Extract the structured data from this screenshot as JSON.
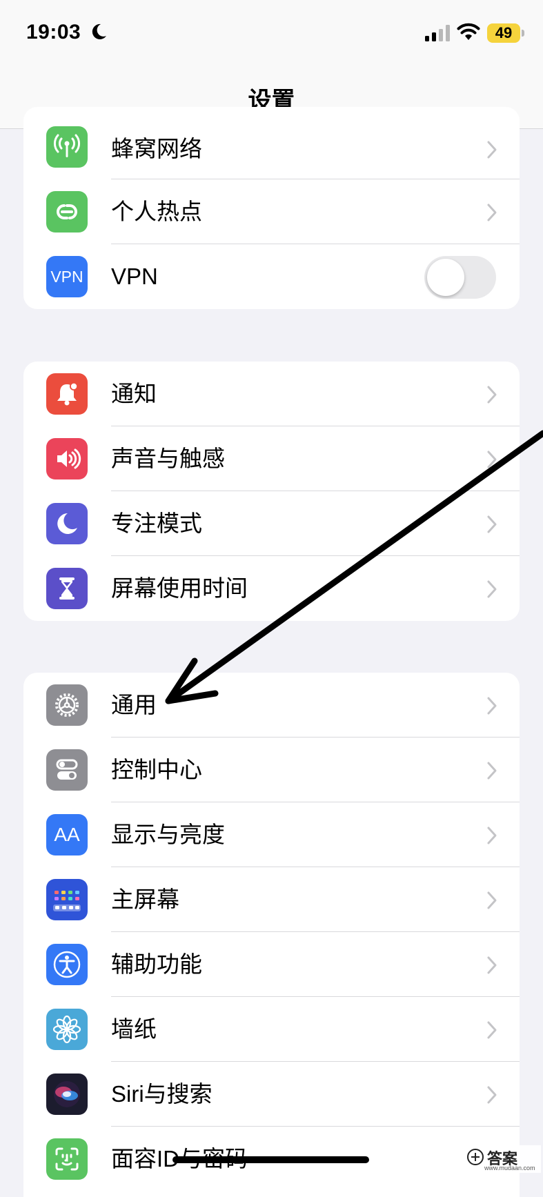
{
  "status_bar": {
    "time": "19:03",
    "battery": "49"
  },
  "nav": {
    "title": "设置"
  },
  "groups": [
    {
      "items": [
        {
          "label": "蜂窝网络",
          "icon": "cellular-antenna-icon",
          "color": "#5ac461"
        },
        {
          "label": "个人热点",
          "icon": "hotspot-link-icon",
          "color": "#5ac461"
        },
        {
          "label": "VPN",
          "icon": "vpn-icon",
          "icon_text": "VPN",
          "color": "#3478f6",
          "toggle": false
        }
      ]
    },
    {
      "items": [
        {
          "label": "通知",
          "icon": "bell-icon",
          "color": "#eb4d3d"
        },
        {
          "label": "声音与触感",
          "icon": "speaker-icon",
          "color": "#eb445a"
        },
        {
          "label": "专注模式",
          "icon": "moon-icon",
          "color": "#5b5bd6"
        },
        {
          "label": "屏幕使用时间",
          "icon": "hourglass-icon",
          "color": "#5b4fc9"
        }
      ]
    },
    {
      "items": [
        {
          "label": "通用",
          "icon": "gear-icon",
          "color": "#8e8e93"
        },
        {
          "label": "控制中心",
          "icon": "toggles-icon",
          "color": "#8e8e93"
        },
        {
          "label": "显示与亮度",
          "icon": "text-size-icon",
          "icon_text": "AA",
          "color": "#3478f6"
        },
        {
          "label": "主屏幕",
          "icon": "home-grid-icon",
          "color": "#2f54d8"
        },
        {
          "label": "辅助功能",
          "icon": "accessibility-icon",
          "color": "#3478f6"
        },
        {
          "label": "墙纸",
          "icon": "flower-icon",
          "color": "#4aa8d8"
        },
        {
          "label": "Siri与搜索",
          "icon": "siri-orb-icon",
          "color": "#1c1c2e"
        },
        {
          "label": "面容ID与密码",
          "icon": "face-id-icon",
          "color": "#5ac461"
        }
      ]
    }
  ],
  "watermark": {
    "text": "答案",
    "url": "www.mudaan.com"
  }
}
